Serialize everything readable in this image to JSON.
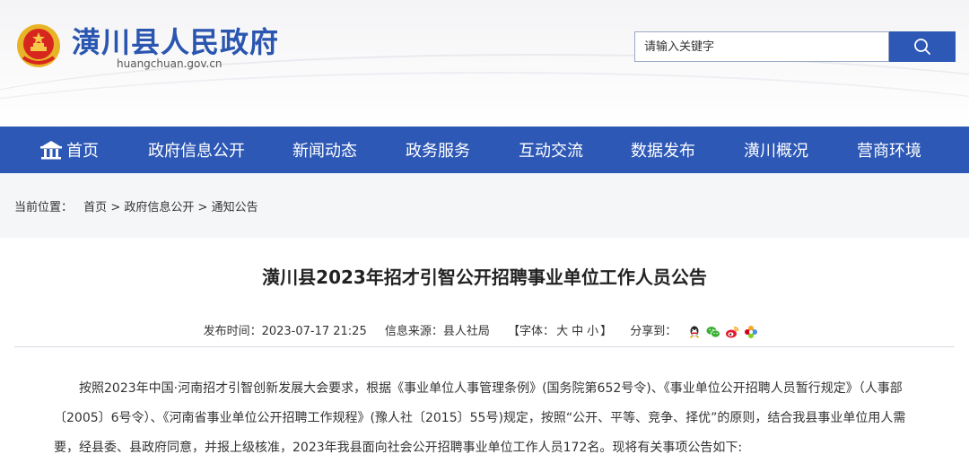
{
  "site": {
    "title": "潢川县人民政府",
    "domain": "huangchuan.gov.cn"
  },
  "search": {
    "placeholder": "请输入关键字"
  },
  "nav": {
    "items": [
      {
        "label": "首页"
      },
      {
        "label": "政府信息公开"
      },
      {
        "label": "新闻动态"
      },
      {
        "label": "政务服务"
      },
      {
        "label": "互动交流"
      },
      {
        "label": "数据发布"
      },
      {
        "label": "潢川概况"
      },
      {
        "label": "营商环境"
      }
    ]
  },
  "breadcrumb": {
    "prefix": "当前位置：",
    "items": [
      "首页",
      "政府信息公开",
      "通知公告"
    ],
    "separator": ">"
  },
  "article": {
    "title": "潢川县2023年招才引智公开招聘事业单位工作人员公告",
    "publish_label": "发布时间：",
    "publish_time": "2023-07-17 21:25",
    "source_label": "信息来源：",
    "source": "县人社局",
    "font_label_open": "【字体：",
    "font_large": "大",
    "font_medium": "中",
    "font_small": "小",
    "font_label_close": "】",
    "share_label": "分享到：",
    "paragraph": "按照2023年中国·河南招才引智创新发展大会要求，根据《事业单位人事管理条例》(国务院第652号令)、《事业单位公开招聘人员暂行规定》（人事部〔2005〕6号令）、《河南省事业单位公开招聘工作规程》(豫人社〔2015〕55号)规定，按照“公开、平等、竞争、择优”的原则，结合我县事业单位用人需要，经县委、县政府同意，并报上级核准，2023年我县面向社会公开招聘事业单位工作人员172名。现将有关事项公告如下:"
  },
  "colors": {
    "brand_blue": "#2d58b5",
    "title_blue": "#2a56b0"
  }
}
